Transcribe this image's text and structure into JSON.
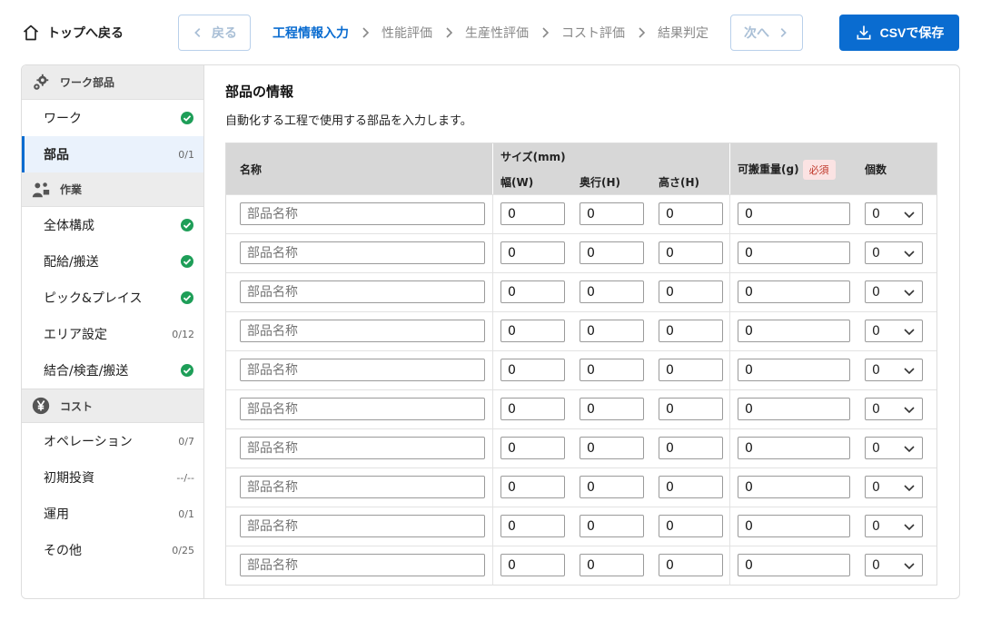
{
  "header": {
    "home_label": "トップへ戻る",
    "back_label": "戻る",
    "next_label": "次へ",
    "csv_label": "CSVで保存",
    "steps": [
      {
        "label": "工程情報入力",
        "active": true
      },
      {
        "label": "性能評価",
        "active": false
      },
      {
        "label": "生産性評価",
        "active": false
      },
      {
        "label": "コスト評価",
        "active": false
      },
      {
        "label": "結果判定",
        "active": false
      }
    ]
  },
  "sidebar": {
    "sections": [
      {
        "title": "ワーク部品",
        "icon": "gears-icon",
        "items": [
          {
            "label": "ワーク",
            "status": "done",
            "count": ""
          },
          {
            "label": "部品",
            "status": "count",
            "count": "0/1",
            "active": true
          }
        ]
      },
      {
        "title": "作業",
        "icon": "worker-icon",
        "items": [
          {
            "label": "全体構成",
            "status": "done",
            "count": ""
          },
          {
            "label": "配給/搬送",
            "status": "done",
            "count": ""
          },
          {
            "label": "ピック&プレイス",
            "status": "done",
            "count": ""
          },
          {
            "label": "エリア設定",
            "status": "count",
            "count": "0/12"
          },
          {
            "label": "結合/検査/搬送",
            "status": "done",
            "count": ""
          }
        ]
      },
      {
        "title": "コスト",
        "icon": "yen-icon",
        "items": [
          {
            "label": "オペレーション",
            "status": "count",
            "count": "0/7"
          },
          {
            "label": "初期投資",
            "status": "count",
            "count": "--/--"
          },
          {
            "label": "運用",
            "status": "count",
            "count": "0/1"
          },
          {
            "label": "その他",
            "status": "count",
            "count": "0/25"
          }
        ]
      }
    ]
  },
  "content": {
    "title": "部品の情報",
    "description": "自動化する工程で使用する部品を入力します。",
    "table": {
      "col_name": "名称",
      "col_size_group": "サイズ(mm)",
      "col_width": "幅(W)",
      "col_depth": "奥行(H)",
      "col_height": "高さ(H)",
      "col_weight": "可搬重量(g)",
      "required_badge": "必須",
      "col_count": "個数",
      "name_placeholder": "部品名称",
      "rows": [
        {
          "name": "",
          "w": "0",
          "d": "0",
          "h": "0",
          "weight": "0",
          "count": "0"
        },
        {
          "name": "",
          "w": "0",
          "d": "0",
          "h": "0",
          "weight": "0",
          "count": "0"
        },
        {
          "name": "",
          "w": "0",
          "d": "0",
          "h": "0",
          "weight": "0",
          "count": "0"
        },
        {
          "name": "",
          "w": "0",
          "d": "0",
          "h": "0",
          "weight": "0",
          "count": "0"
        },
        {
          "name": "",
          "w": "0",
          "d": "0",
          "h": "0",
          "weight": "0",
          "count": "0"
        },
        {
          "name": "",
          "w": "0",
          "d": "0",
          "h": "0",
          "weight": "0",
          "count": "0"
        },
        {
          "name": "",
          "w": "0",
          "d": "0",
          "h": "0",
          "weight": "0",
          "count": "0"
        },
        {
          "name": "",
          "w": "0",
          "d": "0",
          "h": "0",
          "weight": "0",
          "count": "0"
        },
        {
          "name": "",
          "w": "0",
          "d": "0",
          "h": "0",
          "weight": "0",
          "count": "0"
        },
        {
          "name": "",
          "w": "0",
          "d": "0",
          "h": "0",
          "weight": "0",
          "count": "0"
        }
      ]
    }
  },
  "colors": {
    "accent": "#0a6cd0",
    "done": "#1e9e58",
    "header_bg": "#d7d7d7",
    "required": "#c0392b"
  }
}
